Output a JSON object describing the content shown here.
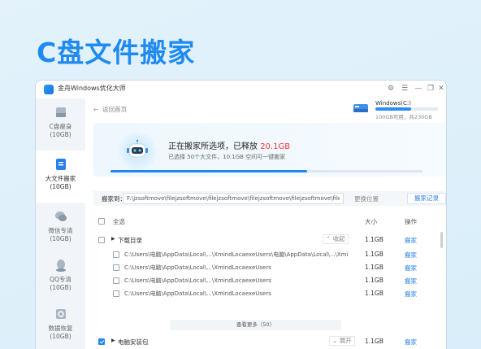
{
  "banner": {
    "title": "C盘文件搬家"
  },
  "window": {
    "app_name": "金舟Windows优化大师",
    "buttons": [
      "gear-icon",
      "menu-icon",
      "minimize-icon",
      "restore-icon",
      "close-icon"
    ]
  },
  "sidebar": {
    "items": [
      {
        "label": "C盘瘦身",
        "sub": "(10GB)",
        "icon": "disk-slim-icon",
        "active": false
      },
      {
        "label": "大文件搬家",
        "sub": "(10GB)",
        "icon": "big-file-move-icon",
        "active": true
      },
      {
        "label": "微信专清",
        "sub": "(10GB)",
        "icon": "wechat-clean-icon",
        "active": false
      },
      {
        "label": "QQ专清",
        "sub": "(10GB)",
        "icon": "qq-clean-icon",
        "active": false
      },
      {
        "label": "数据恢复",
        "sub": "(10GB)",
        "icon": "data-recovery-icon",
        "active": false
      }
    ]
  },
  "main": {
    "back_label": "返回首页",
    "disk": {
      "name": "Windows(C:)",
      "info": "100GB可用，共230GB",
      "used_fraction": 0.57
    },
    "status": {
      "prefix": "正在搬家所选项，已释放 ",
      "amount": "20.1GB",
      "sub": "已选择 50个大文件，10.1GB 空间可一键搬家",
      "progress_fraction": 0.63
    },
    "path_bar": {
      "label": "搬家到：",
      "value": "F:\\jzsoftmove\\filejzsoftmove\\filejzsoftmove\\filejzsoftmove\\filejzsoftmove\\filejzsoftmove\\filejzsoftmove",
      "change_label": "更换位置",
      "history_label": "搬家记录"
    },
    "table": {
      "select_all": "全选",
      "col_size": "大小",
      "col_action": "操作",
      "groups": [
        {
          "name": "下载目录",
          "size": "1.1GB",
          "action": "搬家",
          "toggle": "收起",
          "checked": false
        },
        {
          "name": "电脑安装包",
          "size": "1.1GB",
          "action": "搬家",
          "toggle": "展开",
          "checked": true
        }
      ],
      "rows": [
        {
          "path": "C:\\Users\\电脑\\AppData\\Local\\...\\XmindLocaexeUsers\\电脑\\AppData\\Local\\...\\Xmi",
          "size": "1.1GB",
          "action": "搬家"
        },
        {
          "path": "C:\\Users\\电脑\\AppData\\Local\\...\\XmindLocaexeUsers",
          "size": "1.1GB",
          "action": "搬家"
        },
        {
          "path": "C:\\Users\\电脑\\AppData\\Local\\...\\XmindLocaexeUsers",
          "size": "1.1GB",
          "action": "搬家"
        },
        {
          "path": "C:\\Users\\电脑\\AppData\\Local\\...\\XmindLocaexeUsers",
          "size": "1.1GB",
          "action": "搬家"
        }
      ],
      "load_more": "查看更多（50）"
    }
  },
  "colors": {
    "accent": "#1f86ee",
    "highlight": "#f0353a",
    "banner": "#1f8bf0"
  }
}
